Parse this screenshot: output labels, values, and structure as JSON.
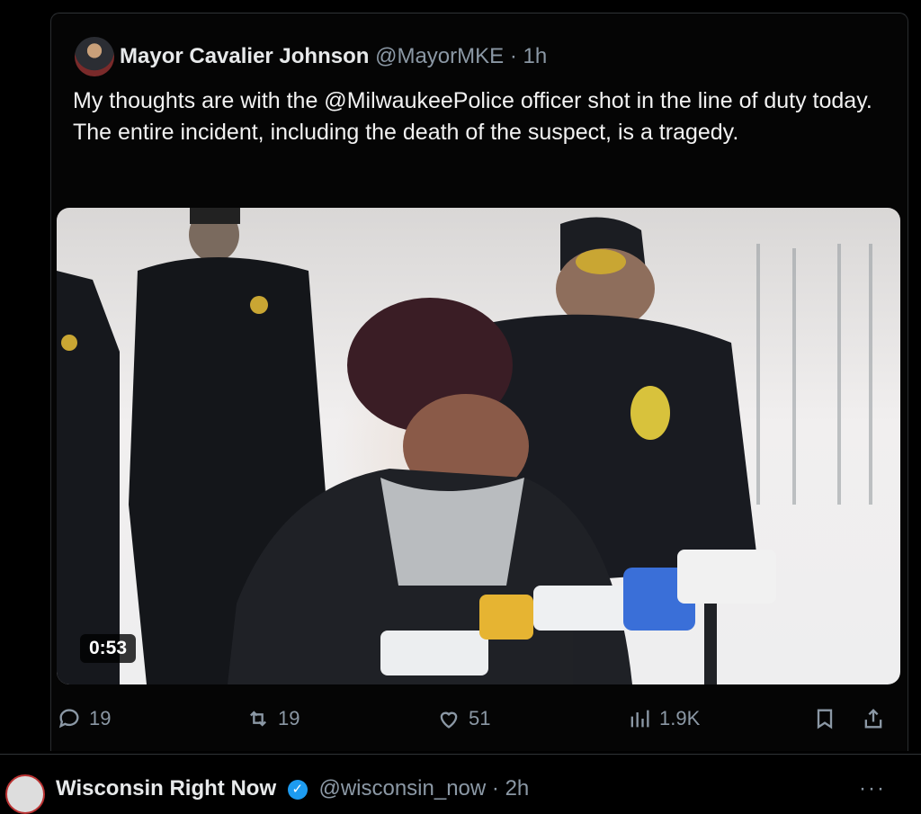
{
  "tweet": {
    "display_name": "Mayor Cavalier Johnson",
    "handle": "@MayorMKE",
    "separator": "·",
    "time": "1h",
    "text": "My thoughts are with the @MilwaukeePolice officer shot in the line of duty today.  The entire incident, including the death of the suspect, is a tragedy.",
    "video_time": "0:53",
    "stats": {
      "replies": "19",
      "reposts": "19",
      "likes": "51",
      "views": "1.9K"
    }
  },
  "next_tweet": {
    "display_name": "Wisconsin Right Now",
    "handle": "@wisconsin_now",
    "separator": "·",
    "time": "2h",
    "more": "···"
  },
  "icons": {
    "reply": "reply-icon",
    "repost": "repost-icon",
    "like": "like-icon",
    "views": "views-icon",
    "bookmark": "bookmark-icon",
    "share": "share-icon",
    "verified": "verified-badge-icon"
  },
  "colors": {
    "background": "#000000",
    "text": "#e7e9ea",
    "secondary": "#8b98a5",
    "verified": "#1d9bf0"
  }
}
